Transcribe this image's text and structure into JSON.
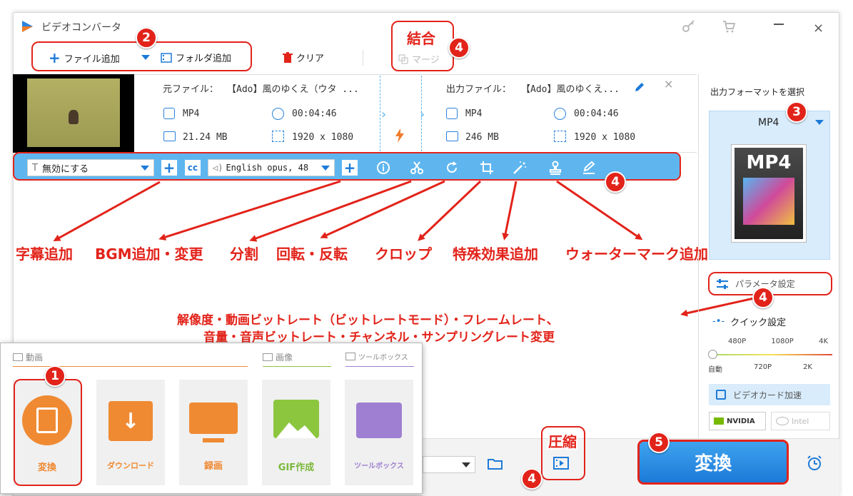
{
  "app": {
    "title": "ビデオコンバータ"
  },
  "toolbar": {
    "add_file": "ファイル追加",
    "add_folder": "フォルダ追加",
    "clear": "クリア",
    "merge": "マージ"
  },
  "file": {
    "source_label": "元ファイル：",
    "source_name": "【Ado】風のゆくえ（ウタ ...",
    "output_label": "出力ファイル：",
    "output_name": "【Ado】風のゆくえ...",
    "src_format": "MP4",
    "src_duration": "00:04:46",
    "src_size": "21.24 MB",
    "src_resolution": "1920 x 1080",
    "out_format": "MP4",
    "out_duration": "00:04:46",
    "out_size": "246 MB",
    "out_resolution": "1920 x 1080"
  },
  "edit_bar": {
    "subtitle_value": "無効にする",
    "audio_value": "English opus, 48"
  },
  "sidebar": {
    "select_format": "出力フォーマットを選択",
    "format": "MP4",
    "format_image_text": "MP4",
    "params": "パラメータ設定",
    "quick": "クイック設定",
    "quality_top": [
      "480P",
      "1080P",
      "4K"
    ],
    "quality_bottom": [
      "自動",
      "720P",
      "2K"
    ],
    "gpu_accel": "ビデオカード加速",
    "nvidia": "NVIDIA",
    "intel": "Intel"
  },
  "bottom": {
    "convert": "変換"
  },
  "panel": {
    "cat_video": "動画",
    "cat_image": "画像",
    "cat_toolbox": "ツールボックス",
    "tiles": [
      "変換",
      "ダウンロード",
      "録画",
      "GIF作成",
      "ツールボックス"
    ]
  },
  "annotations": {
    "merge": "結合",
    "compress": "圧縮",
    "subtitle": "字幕追加",
    "bgm": "BGM追加・変更",
    "split": "分割",
    "rotate": "回転・反転",
    "crop": "クロップ",
    "effects": "特殊効果追加",
    "watermark": "ウォーターマーク追加",
    "params_line1": "解像度・動画ビットレート（ビットレートモード）・フレームレート、",
    "params_line2": "音量・音声ビットレート・チャンネル・サンプリングレート変更",
    "badges": [
      "1",
      "2",
      "3",
      "4",
      "5"
    ]
  },
  "colors": {
    "accent": "#1c7ad8",
    "annotation": "#e2231a",
    "orange": "#ef8a33",
    "toolbar_blue": "#5fb6ef"
  }
}
